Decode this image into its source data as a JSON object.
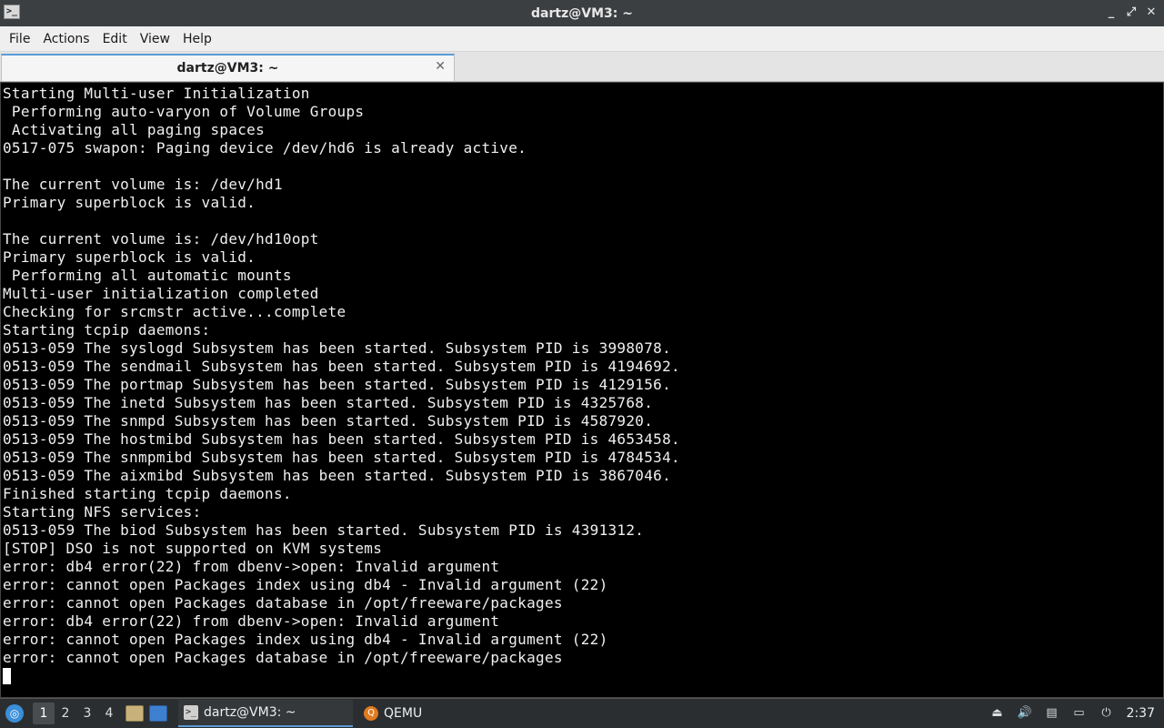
{
  "window": {
    "title": "dartz@VM3: ~",
    "app_icon": ">_",
    "controls": [
      "_",
      "⤢",
      "✕"
    ]
  },
  "menubar": {
    "items": [
      "File",
      "Actions",
      "Edit",
      "View",
      "Help"
    ]
  },
  "tab": {
    "label": "dartz@VM3: ~",
    "close": "✕"
  },
  "terminal": {
    "lines": [
      "Starting Multi-user Initialization",
      " Performing auto-varyon of Volume Groups",
      " Activating all paging spaces",
      "0517-075 swapon: Paging device /dev/hd6 is already active.",
      "",
      "The current volume is: /dev/hd1",
      "Primary superblock is valid.",
      "",
      "The current volume is: /dev/hd10opt",
      "Primary superblock is valid.",
      " Performing all automatic mounts",
      "Multi-user initialization completed",
      "Checking for srcmstr active...complete",
      "Starting tcpip daemons:",
      "0513-059 The syslogd Subsystem has been started. Subsystem PID is 3998078.",
      "0513-059 The sendmail Subsystem has been started. Subsystem PID is 4194692.",
      "0513-059 The portmap Subsystem has been started. Subsystem PID is 4129156.",
      "0513-059 The inetd Subsystem has been started. Subsystem PID is 4325768.",
      "0513-059 The snmpd Subsystem has been started. Subsystem PID is 4587920.",
      "0513-059 The hostmibd Subsystem has been started. Subsystem PID is 4653458.",
      "0513-059 The snmpmibd Subsystem has been started. Subsystem PID is 4784534.",
      "0513-059 The aixmibd Subsystem has been started. Subsystem PID is 3867046.",
      "Finished starting tcpip daemons.",
      "Starting NFS services:",
      "0513-059 The biod Subsystem has been started. Subsystem PID is 4391312.",
      "[STOP] DSO is not supported on KVM systems",
      "error: db4 error(22) from dbenv->open: Invalid argument",
      "error: cannot open Packages index using db4 - Invalid argument (22)",
      "error: cannot open Packages database in /opt/freeware/packages",
      "error: db4 error(22) from dbenv->open: Invalid argument",
      "error: cannot open Packages index using db4 - Invalid argument (22)",
      "error: cannot open Packages database in /opt/freeware/packages"
    ]
  },
  "taskbar": {
    "desktops": [
      "1",
      "2",
      "3",
      "4"
    ],
    "active_desktop": "1",
    "tasks": [
      {
        "label": "dartz@VM3: ~",
        "icon": ">_",
        "active": true
      },
      {
        "label": "QEMU",
        "icon": "Q",
        "active": false
      }
    ],
    "tray_icons": [
      "⏏",
      "🔊",
      "▤",
      "▭",
      "⏻"
    ],
    "clock": "2:37"
  }
}
